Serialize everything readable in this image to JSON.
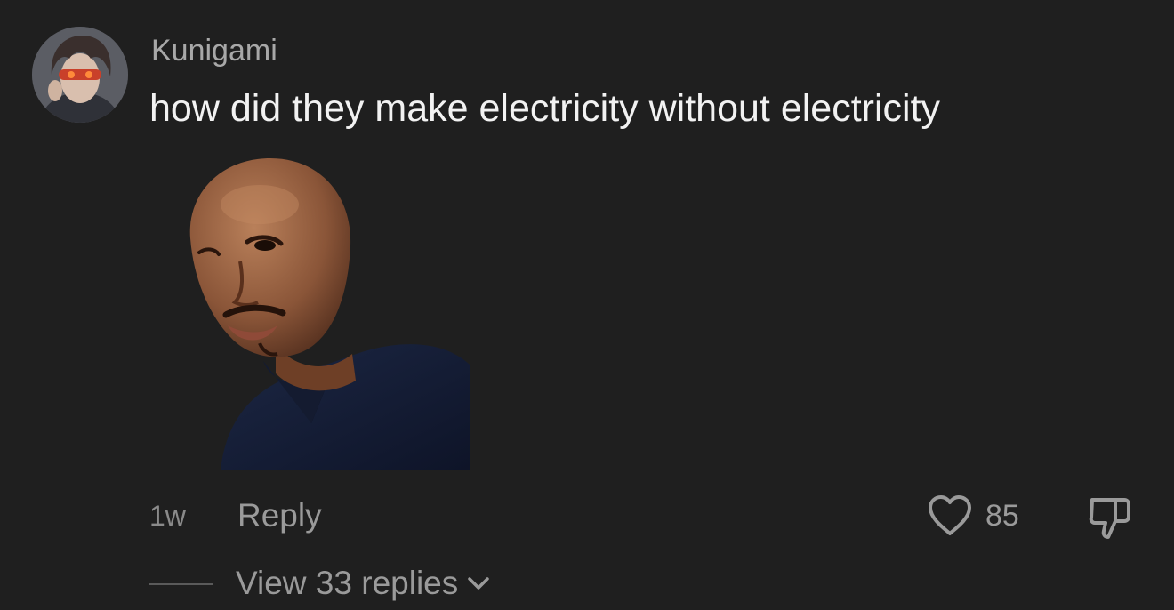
{
  "comment": {
    "username": "Kunigami",
    "text": "how did they make electricity without electricity",
    "timestamp": "1w",
    "reply_label": "Reply",
    "like_count": "85",
    "view_replies_label": "View 33 replies"
  },
  "icons": {
    "avatar": "user-avatar-icon",
    "sticker": "sticker-image",
    "like": "heart-icon",
    "dislike": "thumbs-down-icon",
    "expand": "chevron-down-icon"
  },
  "colors": {
    "background": "#1f1f1f",
    "primary_text": "#f2f2f2",
    "secondary_text": "#9a9a9a"
  }
}
